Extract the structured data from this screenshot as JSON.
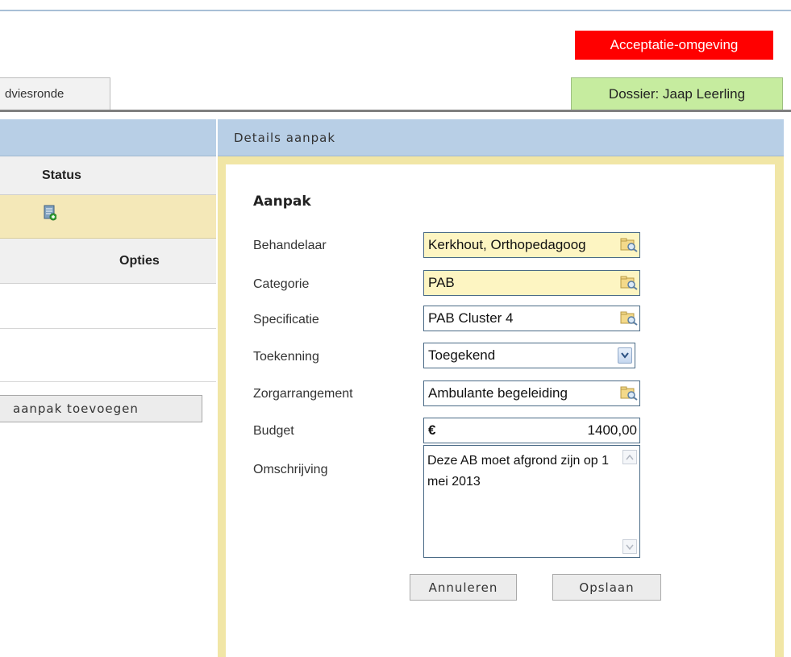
{
  "environment": {
    "label": "Acceptatie-omgeving",
    "color": "#ff0000"
  },
  "tabs": {
    "advies_label": "dviesronde"
  },
  "dossier": {
    "label": "Dossier: Jaap Leerling",
    "color": "#c6ec9f"
  },
  "details_header": {
    "title": "Details aanpak"
  },
  "left_table": {
    "status_header": "Status",
    "opties_header": "Opties",
    "status_icon": "document-add-icon",
    "add_button_label": "aanpak toevoegen"
  },
  "form": {
    "title": "Aanpak",
    "fields": {
      "behandelaar": {
        "label": "Behandelaar",
        "value": "Kerkhout, Orthopedagoog",
        "icon": "lookup-icon"
      },
      "categorie": {
        "label": "Categorie",
        "value": "PAB",
        "icon": "lookup-icon"
      },
      "specificatie": {
        "label": "Specificatie",
        "value": "PAB Cluster 4",
        "icon": "lookup-icon"
      },
      "toekenning": {
        "label": "Toekenning",
        "value": "Toegekend",
        "icon": "chevron-down-icon"
      },
      "zorgarrangement": {
        "label": "Zorgarrangement",
        "value": "Ambulante begeleiding",
        "icon": "lookup-icon"
      },
      "budget": {
        "label": "Budget",
        "currency": "€",
        "value": "1400,00"
      },
      "omschrijving": {
        "label": "Omschrijving",
        "value": "Deze AB moet afgrond zijn op 1 mei 2013"
      }
    },
    "buttons": {
      "cancel": "Annuleren",
      "save": "Opslaan"
    }
  }
}
